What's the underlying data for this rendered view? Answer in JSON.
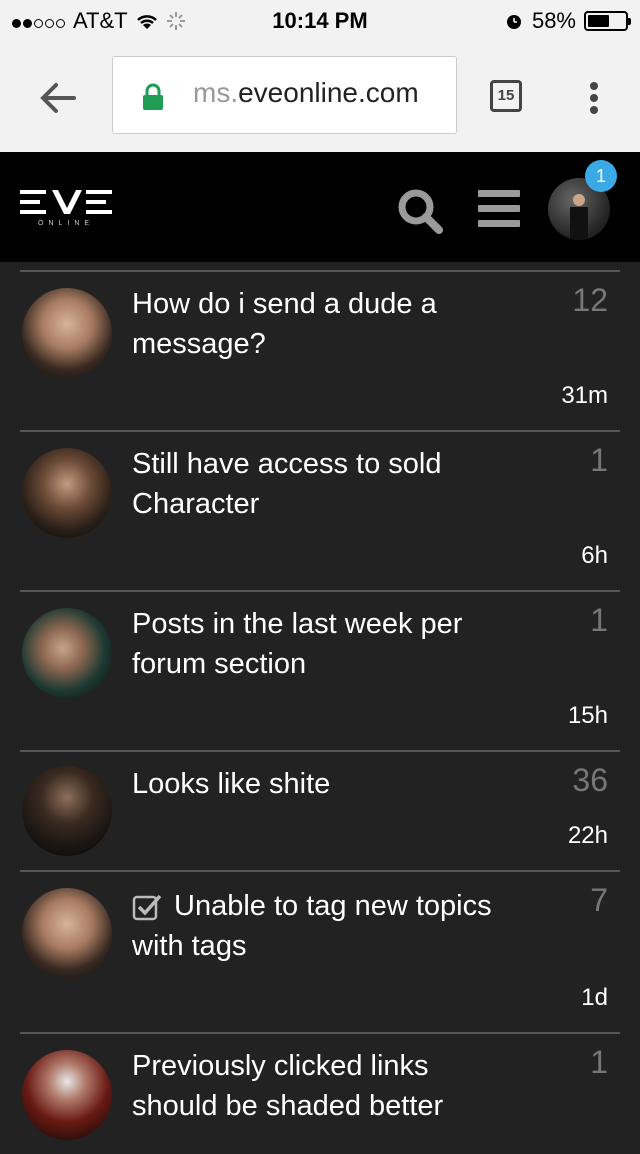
{
  "status_bar": {
    "carrier": "AT&T",
    "time": "10:14 PM",
    "battery": "58%",
    "battery_level": 0.58
  },
  "browser": {
    "url_prefix": "ms.",
    "url_domain": "eveonline.com",
    "tab_count": "15"
  },
  "header": {
    "logo_text": "EVE",
    "logo_sub": "ONLINE",
    "notification_count": "1"
  },
  "topics": [
    {
      "title": "How do i send a dude a message?",
      "count": "12",
      "time": "31m",
      "checked": false
    },
    {
      "title": "Still have access to sold Character",
      "count": "1",
      "time": "6h",
      "checked": false
    },
    {
      "title": "Posts in the last week per forum section",
      "count": "1",
      "time": "15h",
      "checked": false
    },
    {
      "title": "Looks like shite",
      "count": "36",
      "time": "22h",
      "checked": false
    },
    {
      "title": "Unable to tag new topics with tags",
      "count": "7",
      "time": "1d",
      "checked": true
    },
    {
      "title": "Previously clicked links should be shaded better",
      "count": "1",
      "time": "",
      "checked": false
    }
  ],
  "colors": {
    "background": "#222222",
    "header": "#000000",
    "badge": "#3aa9e6",
    "secure_lock": "#1f9d55"
  },
  "icons": [
    "back-arrow-icon",
    "lock-icon",
    "search-icon",
    "hamburger-icon",
    "menu-dots-icon",
    "checkbox-checked-icon",
    "wifi-icon",
    "alarm-icon"
  ]
}
